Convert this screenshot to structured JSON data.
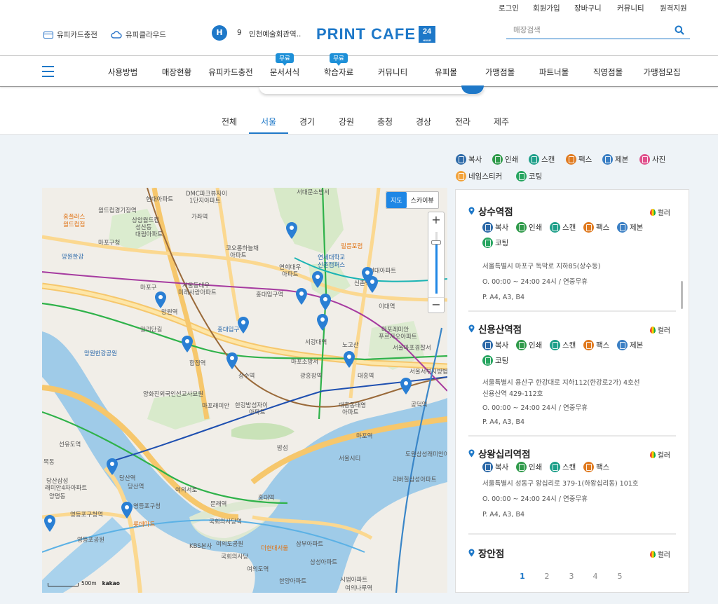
{
  "topbar": {
    "links": [
      "로그인",
      "회원가입",
      "장바구니",
      "커뮤니티",
      "원격지원"
    ]
  },
  "header": {
    "upicard": "유피카드충전",
    "upicloud": "유피클라우드",
    "notice_badge": "H",
    "notice_num": "9",
    "notice_text": "인천예술회관역..",
    "logo_text": "PRINT CAFE",
    "logo_badge": "24",
    "logo_badge_small": "HOUR",
    "search_placeholder": "매장검색"
  },
  "gnb": {
    "items": [
      "사용방법",
      "매장현황",
      "유피카드충전",
      "문서서식",
      "학습자료",
      "커뮤니티",
      "유피몰",
      "가맹점몰",
      "파트너몰",
      "직영점몰",
      "가맹점모집"
    ],
    "free_badge": "무료"
  },
  "region_tabs": {
    "items": [
      "전체",
      "서울",
      "경기",
      "강원",
      "충청",
      "경상",
      "전라",
      "제주"
    ],
    "active": "서울"
  },
  "legend": [
    {
      "label": "복사",
      "color": "#2d6aa8"
    },
    {
      "label": "인쇄",
      "color": "#2f9a4a"
    },
    {
      "label": "스캔",
      "color": "#1fa08a"
    },
    {
      "label": "팩스",
      "color": "#e07a1f"
    },
    {
      "label": "제본",
      "color": "#3a7fc4"
    },
    {
      "label": "사진",
      "color": "#e0508c"
    },
    {
      "label": "네임스티커",
      "color": "#f2a23a"
    },
    {
      "label": "코팅",
      "color": "#27a560"
    }
  ],
  "map": {
    "type_map": "지도",
    "type_sky": "스카이뷰",
    "zoom_in": "+",
    "zoom_out": "−",
    "scale": "500m",
    "provider": "kakao",
    "labels": [
      "DMC파크뷰자이",
      "1단지아파트",
      "서대문소방서",
      "현대아파트",
      "가좌역",
      "월드컵경기장역",
      "홈플러스",
      "월드컵점",
      "상암월드컵",
      "성산동",
      "대림아파트",
      "마포구청",
      "망원한강",
      "코오롱하늘채",
      "아파트",
      "연세대학교",
      "신촌캠퍼스",
      "연희대우",
      "아파트",
      "필름포럼",
      "현대아파트",
      "서울동대우",
      "미래사랑아파트",
      "홍대입구역",
      "신촌역",
      "이대역",
      "마포구",
      "망원역",
      "합정역",
      "홍대입구",
      "상수역",
      "광흥창역",
      "대흥역",
      "마포레미안",
      "푸르지오아파트",
      "서울마포경찰서",
      "노고산",
      "서강대역",
      "망리단길",
      "망원한강공원",
      "마포소방서",
      "서울서부지방법원",
      "공덕역",
      "양화진외국인선교사묘원",
      "마포래미안",
      "한강밤섬자이",
      "아파트",
      "대흥동태영",
      "아파트",
      "당산역",
      "영등포구청역",
      "영등포구청",
      "영등포공원",
      "국회의사당역",
      "여의도공원",
      "KBS본사",
      "더현대서울",
      "삼부아파트",
      "여의도역",
      "한양아파트",
      "선유도역",
      "목동",
      "여의서로",
      "밤섬",
      "마포역",
      "서울시티",
      "시범아파트",
      "여의나루역",
      "홍대역",
      "문래역",
      "도원삼성래미안아파트",
      "리버힐삼성아파트",
      "롯데마트",
      "양평동",
      "당산삼성",
      "래미안4차아파트",
      "국회의사당",
      "삼성아파트",
      "당산역"
    ]
  },
  "stores": [
    {
      "name": "상수역점",
      "color_label": "컬러",
      "services": [
        "복사",
        "인쇄",
        "스캔",
        "팩스",
        "제본",
        "코팅"
      ],
      "address": "서울특별시 마포구 독막로 지하85(상수동)",
      "address2": "",
      "hours": "O. 00:00 ~ 24:00 24시 / 연중무휴",
      "paper": "P. A4, A3, B4"
    },
    {
      "name": "신용산역점",
      "color_label": "컬러",
      "services": [
        "복사",
        "인쇄",
        "스캔",
        "팩스",
        "제본",
        "코팅"
      ],
      "address": "서울특별시 용산구 한강대로 지하112(한강로2가) 4호선",
      "address2": "신용산역 429-112호",
      "hours": "O. 00:00 ~ 24:00 24시 / 연중무휴",
      "paper": "P. A4, A3, B4"
    },
    {
      "name": "상왕십리역점",
      "color_label": "컬러",
      "services": [
        "복사",
        "인쇄",
        "스캔",
        "팩스"
      ],
      "address": "서울특별시 성동구 왕십리로 379-1(하왕십리동) 101호",
      "address2": "",
      "hours": "O. 00:00 ~ 24:00 24시 / 연중무휴",
      "paper": "P. A4, A3, B4"
    },
    {
      "name": "장안점",
      "color_label": "컬러",
      "services": [],
      "address": "",
      "address2": "",
      "hours": "",
      "paper": ""
    }
  ],
  "pagination": {
    "pages": [
      "1",
      "2",
      "3",
      "4",
      "5"
    ],
    "active": "1"
  }
}
